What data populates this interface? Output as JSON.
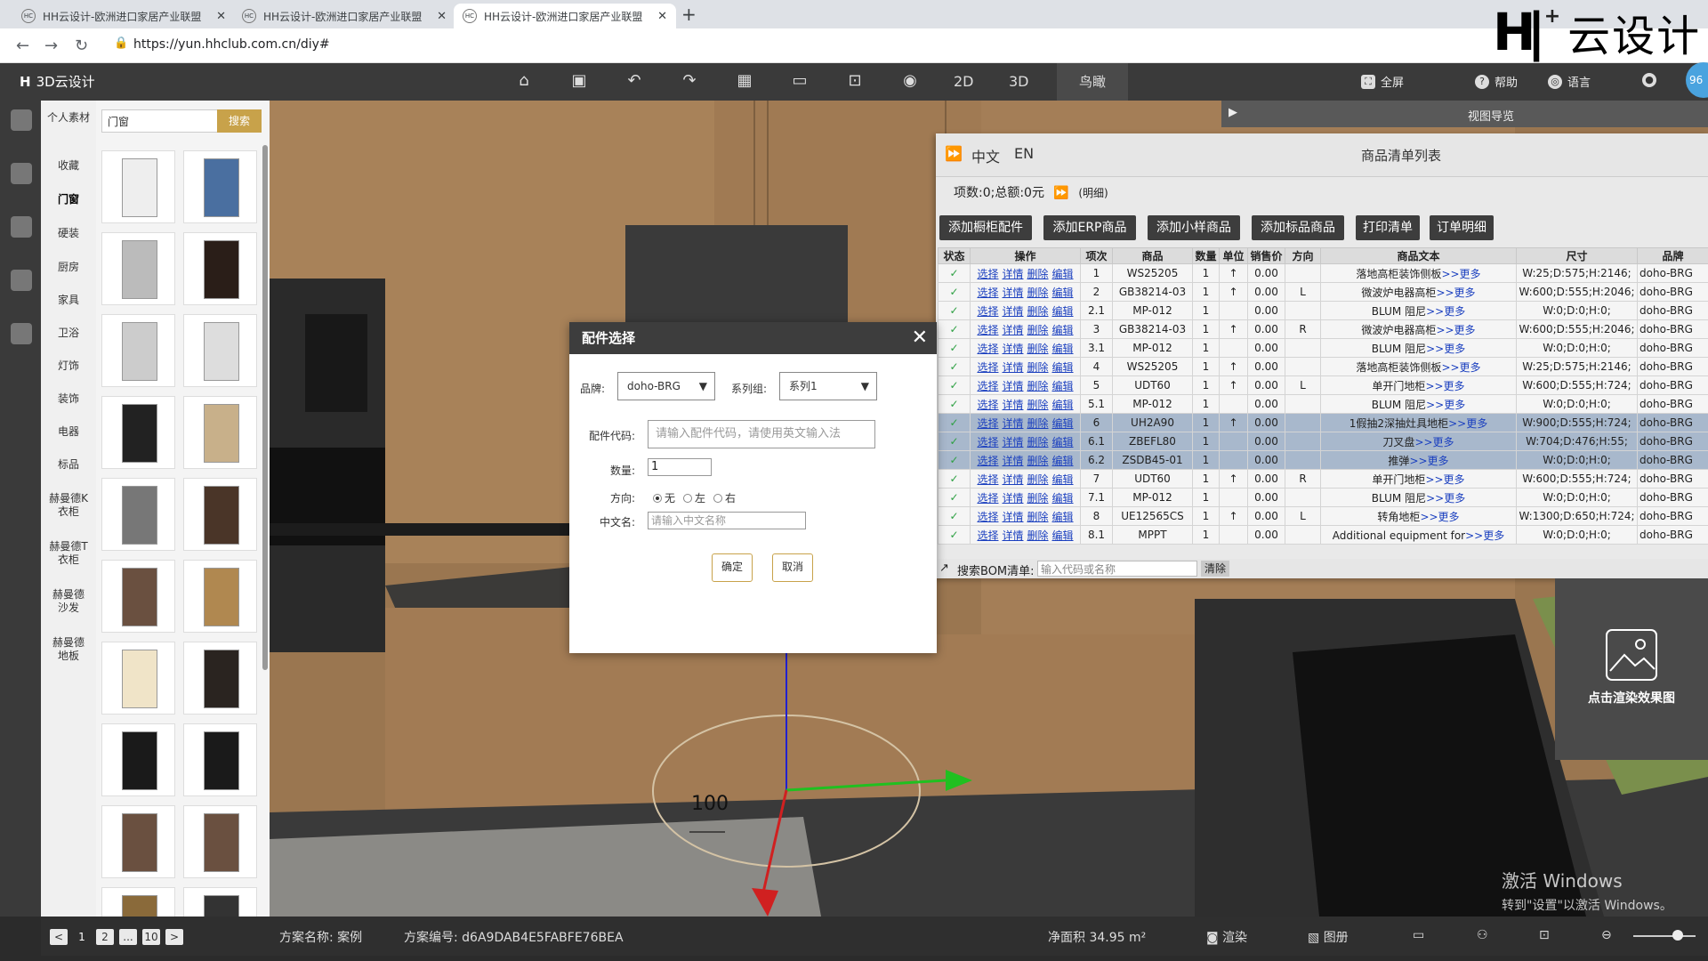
{
  "browser": {
    "tabs": [
      {
        "title": "HH云设计-欧洲进口家居产业联盟",
        "active": false
      },
      {
        "title": "HH云设计-欧洲进口家居产业联盟",
        "active": false
      },
      {
        "title": "HH云设计-欧洲进口家居产业联盟",
        "active": true
      }
    ],
    "url": "https://yun.hhclub.com.cn/diy#",
    "favicon_text": "HC"
  },
  "overlay_logo": {
    "mark": "H",
    "plus": "+",
    "text": "云设计"
  },
  "toolbar": {
    "app_title": "3D云设计",
    "icons": [
      "home-icon",
      "save-icon",
      "undo-icon",
      "redo-icon",
      "layout-icon",
      "box-icon",
      "frame-icon",
      "eye-icon"
    ],
    "view_2d": "2D",
    "view_3d": "3D",
    "view_bird": "鸟瞰",
    "fullscreen": "全屏",
    "help": "帮助",
    "language": "语言",
    "avatar_text": "96"
  },
  "categories": [
    "个人素材",
    "收藏",
    "门窗",
    "硬装",
    "厨房",
    "家具",
    "卫浴",
    "灯饰",
    "装饰",
    "电器",
    "标品",
    "赫曼德K衣柜",
    "赫曼德T衣柜",
    "赫曼德沙发",
    "赫曼德地板"
  ],
  "asset_panel": {
    "search_value": "门窗",
    "search_button": "搜索"
  },
  "viewport": {
    "dimension_label": "100"
  },
  "view_nav": {
    "label": "视图导览"
  },
  "product_list": {
    "lang_zh": "中文",
    "lang_en": "EN",
    "title": "商品清单列表",
    "summary": "项数:0;总额:0元",
    "detail_link": "(明细)",
    "buttons": [
      "添加橱柜配件",
      "添加ERP商品",
      "添加小样商品",
      "添加标品商品",
      "打印清单",
      "订单明细"
    ],
    "columns": [
      "状态",
      "操作",
      "项次",
      "商品",
      "数量",
      "单位",
      "销售价",
      "方向",
      "商品文本",
      "尺寸",
      "品牌"
    ],
    "op_links": [
      "选择",
      "详情",
      "删除",
      "编辑"
    ],
    "more_text": ">>更多",
    "rows": [
      {
        "no": "1",
        "code": "WS25205",
        "qty": "1",
        "unit": "↑",
        "price": "0.00",
        "dir": "",
        "text": "落地高柜装饰侧板",
        "size": "W:25;D:575;H:2146;",
        "brand": "doho-BRG"
      },
      {
        "no": "2",
        "code": "GB38214-03",
        "qty": "1",
        "unit": "↑",
        "price": "0.00",
        "dir": "L",
        "text": "微波炉电器高柜",
        "size": "W:600;D:555;H:2046;",
        "brand": "doho-BRG"
      },
      {
        "no": "2.1",
        "code": "MP-012",
        "qty": "1",
        "unit": "",
        "price": "0.00",
        "dir": "",
        "text": "BLUM 阻尼",
        "size": "W:0;D:0;H:0;",
        "brand": "doho-BRG"
      },
      {
        "no": "3",
        "code": "GB38214-03",
        "qty": "1",
        "unit": "↑",
        "price": "0.00",
        "dir": "R",
        "text": "微波炉电器高柜",
        "size": "W:600;D:555;H:2046;",
        "brand": "doho-BRG"
      },
      {
        "no": "3.1",
        "code": "MP-012",
        "qty": "1",
        "unit": "",
        "price": "0.00",
        "dir": "",
        "text": "BLUM 阻尼",
        "size": "W:0;D:0;H:0;",
        "brand": "doho-BRG"
      },
      {
        "no": "4",
        "code": "WS25205",
        "qty": "1",
        "unit": "↑",
        "price": "0.00",
        "dir": "",
        "text": "落地高柜装饰侧板",
        "size": "W:25;D:575;H:2146;",
        "brand": "doho-BRG"
      },
      {
        "no": "5",
        "code": "UDT60",
        "qty": "1",
        "unit": "↑",
        "price": "0.00",
        "dir": "L",
        "text": "单开门地柜",
        "size": "W:600;D:555;H:724;",
        "brand": "doho-BRG"
      },
      {
        "no": "5.1",
        "code": "MP-012",
        "qty": "1",
        "unit": "",
        "price": "0.00",
        "dir": "",
        "text": "BLUM 阻尼",
        "size": "W:0;D:0;H:0;",
        "brand": "doho-BRG"
      },
      {
        "no": "6",
        "code": "UH2A90",
        "qty": "1",
        "unit": "↑",
        "price": "0.00",
        "dir": "",
        "text": "1假抽2深抽灶具地柜",
        "size": "W:900;D:555;H:724;",
        "brand": "doho-BRG",
        "selected": true
      },
      {
        "no": "6.1",
        "code": "ZBEFL80",
        "qty": "1",
        "unit": "",
        "price": "0.00",
        "dir": "",
        "text": "刀叉盘",
        "size": "W:704;D:476;H:55;",
        "brand": "doho-BRG",
        "selected": true
      },
      {
        "no": "6.2",
        "code": "ZSDB45-01",
        "qty": "1",
        "unit": "",
        "price": "0.00",
        "dir": "",
        "text": "推弹",
        "size": "W:0;D:0;H:0;",
        "brand": "doho-BRG",
        "selected": true
      },
      {
        "no": "7",
        "code": "UDT60",
        "qty": "1",
        "unit": "↑",
        "price": "0.00",
        "dir": "R",
        "text": "单开门地柜",
        "size": "W:600;D:555;H:724;",
        "brand": "doho-BRG"
      },
      {
        "no": "7.1",
        "code": "MP-012",
        "qty": "1",
        "unit": "",
        "price": "0.00",
        "dir": "",
        "text": "BLUM 阻尼",
        "size": "W:0;D:0;H:0;",
        "brand": "doho-BRG"
      },
      {
        "no": "8",
        "code": "UE12565CS",
        "qty": "1",
        "unit": "↑",
        "price": "0.00",
        "dir": "L",
        "text": "转角地柜",
        "size": "W:1300;D:650;H:724;",
        "brand": "doho-BRG"
      },
      {
        "no": "8.1",
        "code": "MPPT",
        "qty": "1",
        "unit": "",
        "price": "0.00",
        "dir": "",
        "text": "Additional equipment for",
        "size": "W:0;D:0;H:0;",
        "brand": "doho-BRG"
      }
    ],
    "bom_label": "搜索BOM清单:",
    "bom_placeholder": "输入代码或名称",
    "bom_clear": "清除"
  },
  "render_box": {
    "label": "点击渲染效果图"
  },
  "dialog": {
    "title": "配件选择",
    "brand_label": "品牌:",
    "brand_value": "doho-BRG",
    "series_label": "系列组:",
    "series_value": "系列1",
    "code_label": "配件代码:",
    "code_placeholder": "请输入配件代码，请使用英文输入法",
    "qty_label": "数量:",
    "qty_value": "1",
    "dir_label": "方向:",
    "dir_options": [
      "无",
      "左",
      "右"
    ],
    "dir_selected": "无",
    "cn_label": "中文名:",
    "cn_placeholder": "请输入中文名称",
    "ok": "确定",
    "cancel": "取消"
  },
  "statusbar": {
    "pages": [
      "1",
      "2",
      "...",
      "10"
    ],
    "plan_name_label": "方案名称:",
    "plan_name": "案例",
    "plan_id_label": "方案编号:",
    "plan_id": "d6A9DAB4E5FABFE76BEA",
    "area": "净面积 34.95 m²",
    "render": "渲染",
    "gallery": "图册"
  },
  "watermark": {
    "line1": "激活 Windows",
    "line2": "转到\"设置\"以激活 Windows。"
  }
}
